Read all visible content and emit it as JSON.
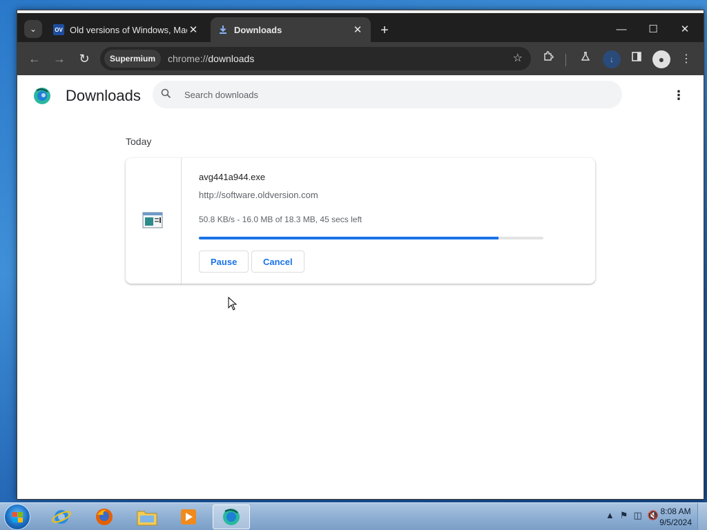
{
  "browser": {
    "tabs": [
      {
        "label": "Old versions of Windows, Mac",
        "favicon": "ov-favicon",
        "active": false
      },
      {
        "label": "Downloads",
        "favicon": "download-icon",
        "active": true
      }
    ],
    "ov_favicon_text": "OV",
    "omnibox": {
      "chip": "Supermium",
      "url_scheme": "chrome://",
      "url_path": "downloads"
    }
  },
  "page": {
    "title": "Downloads",
    "search_placeholder": "Search downloads",
    "section_date": "Today"
  },
  "download": {
    "filename": "avg441a944.exe",
    "url": "http://software.oldversion.com",
    "status": "50.8 KB/s - 16.0 MB of 18.3 MB, 45 secs left",
    "progress_percent": 87,
    "pause_label": "Pause",
    "cancel_label": "Cancel"
  },
  "taskbar": {
    "apps": [
      "internet-explorer",
      "firefox",
      "file-explorer",
      "media-player",
      "supermium"
    ],
    "time": "8:08 AM",
    "date": "9/5/2024"
  },
  "colors": {
    "accent": "#1a73e8",
    "tabstrip": "#1f1f1f",
    "toolbar": "#3c3c3c"
  }
}
